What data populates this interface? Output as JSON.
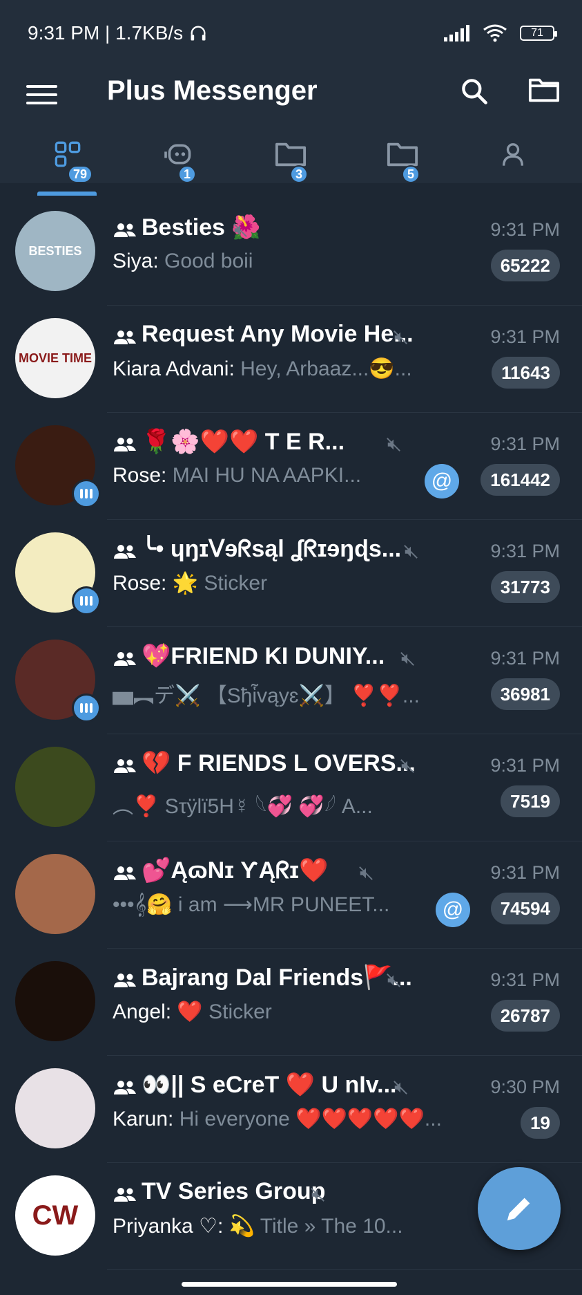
{
  "status_bar": {
    "time_speed": "9:31 PM | 1.7KB/s",
    "battery": "71"
  },
  "app_bar": {
    "title": "Plus Messenger"
  },
  "tabs": [
    {
      "icon": "all-chats-icon",
      "badge": "79",
      "selected": true
    },
    {
      "icon": "bot-icon",
      "badge": "1"
    },
    {
      "icon": "folder-icon",
      "badge": "3"
    },
    {
      "icon": "folder-icon",
      "badge": "5"
    },
    {
      "icon": "user-icon",
      "badge": ""
    }
  ],
  "chats": [
    {
      "title": "Besties 🌺",
      "time": "9:31 PM",
      "sender": "Siya:",
      "message": "Good boii",
      "unread": "65222",
      "avatar_color": "#9fb6c4",
      "avatar_text": "BESTIES"
    },
    {
      "title": "Request Any Movie He...",
      "time": "9:31 PM",
      "sender": "Kiara Advani:",
      "message": "Hey, Arbaaz...😎...",
      "unread": "11643",
      "avatar_color": "#f2f2f2",
      "avatar_text": "MOVIE TIME"
    },
    {
      "title": "🌹🌸❤️❤️ T E R...",
      "time": "9:31 PM",
      "sender": "Rose:",
      "message": "MAI HU NA AAPKI...",
      "unread": "161442",
      "mention": "@",
      "avatar_color": "#3a1c12",
      "avatar_text": ""
    },
    {
      "title": "╰• ɥŋɪᐯɘᖇsąl ʆᖇɪɘŋɖs...",
      "time": "9:31 PM",
      "sender": "Rose:",
      "message": "🌟 Sticker",
      "unread": "31773",
      "avatar_color": "#f3ecc0",
      "avatar_text": ""
    },
    {
      "title": "💖FRIEND KI DUNIY...",
      "time": "9:31 PM",
      "sender": "",
      "message": "▅︻デ⚔️ 【Sђἷvąyɛ⚔️】 ❣️❣️...",
      "unread": "36981",
      "avatar_color": "#5a2a26",
      "avatar_text": ""
    },
    {
      "title": "💔 F RIENDS L OVERS...",
      "time": "9:31 PM",
      "sender": "",
      "message": "︵❣️ Sτÿlï5H☿ 𓆩💞 💞𓆪 A...",
      "unread": "7519",
      "avatar_color": "#3c4a1e",
      "avatar_text": ""
    },
    {
      "title": "💕ĄɷNɪ ƳĄᖇɪ❤️",
      "time": "9:31 PM",
      "sender": "",
      "message": "•••𝄞🤗 i am ⟶MR PUNEET...",
      "unread": "74594",
      "mention": "@",
      "avatar_color": "#a4684a",
      "avatar_text": ""
    },
    {
      "title": "Bajrang Dal Friends🚩...",
      "time": "9:31 PM",
      "sender": "Angel:",
      "message": "❤️ Sticker",
      "unread": "26787",
      "avatar_color": "#1a0f0a",
      "avatar_text": ""
    },
    {
      "title": "👀|| S eCreT ❤️ U nIv...",
      "time": "9:30 PM",
      "sender": "Karun:",
      "message": "Hi everyone ❤️❤️❤️❤️❤️...",
      "unread": "19",
      "avatar_color": "#e8e1e6",
      "avatar_text": ""
    },
    {
      "title": "TV Series Group",
      "time": "",
      "sender": "Priyanka ♡:",
      "message": "💫 Title » The 10...",
      "unread": "",
      "avatar_color": "#ffffff",
      "avatar_text": "CW"
    }
  ]
}
